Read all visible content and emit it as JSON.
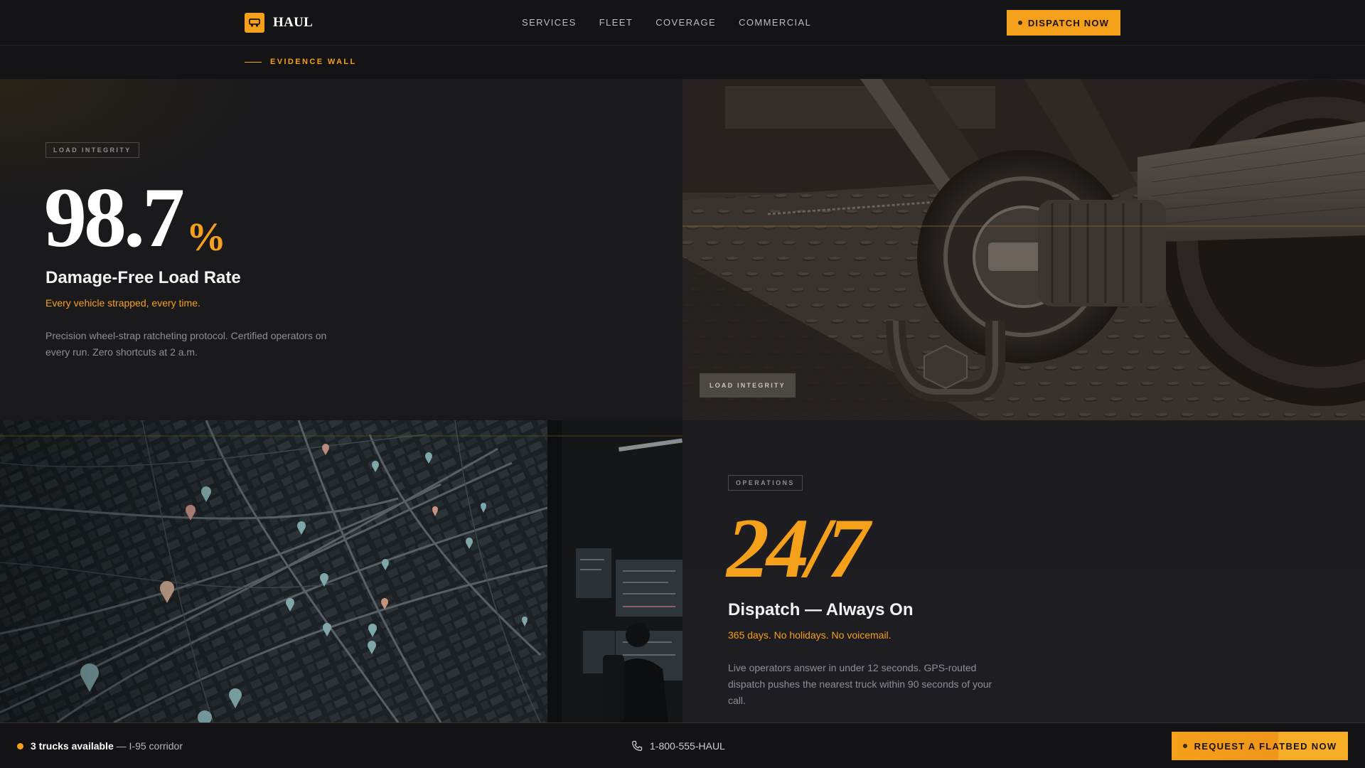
{
  "brand": {
    "name": "HAUL",
    "accent": "#f5a01a",
    "icon": "truck-icon"
  },
  "nav": {
    "links": [
      "SERVICES",
      "FLEET",
      "COVERAGE",
      "COMMERCIAL"
    ],
    "cta": "DISPATCH NOW"
  },
  "eyebrow": "EVIDENCE WALL",
  "load_panel": {
    "tag": "LOAD INTEGRITY",
    "value": "98.7",
    "unit": "%",
    "title": "Damage-Free Load Rate",
    "subtitle": "Every vehicle strapped, every time.",
    "body": "Precision wheel-strap ratcheting protocol. Certified operators on every run. Zero shortcuts at 2 a.m."
  },
  "load_photo": {
    "tag": "LOAD INTEGRITY",
    "subject": "wheel-strap ratchet on flatbed deck"
  },
  "map_photo": {
    "subject": "dispatch map with route pins and operator at monitors"
  },
  "ops_panel": {
    "tag": "OPERATIONS",
    "value": "24/7",
    "title": "Dispatch — Always On",
    "subtitle": "365 days. No holidays. No voicemail.",
    "body": "Live operators answer in under 12 seconds. GPS-routed dispatch pushes the nearest truck within 90 seconds of your call."
  },
  "bottom_bar": {
    "availability_strong": "3 trucks available",
    "availability_rest": " — I-95 corridor",
    "phone": "1-800-555-HAUL",
    "cta": "REQUEST A FLATBED NOW"
  }
}
